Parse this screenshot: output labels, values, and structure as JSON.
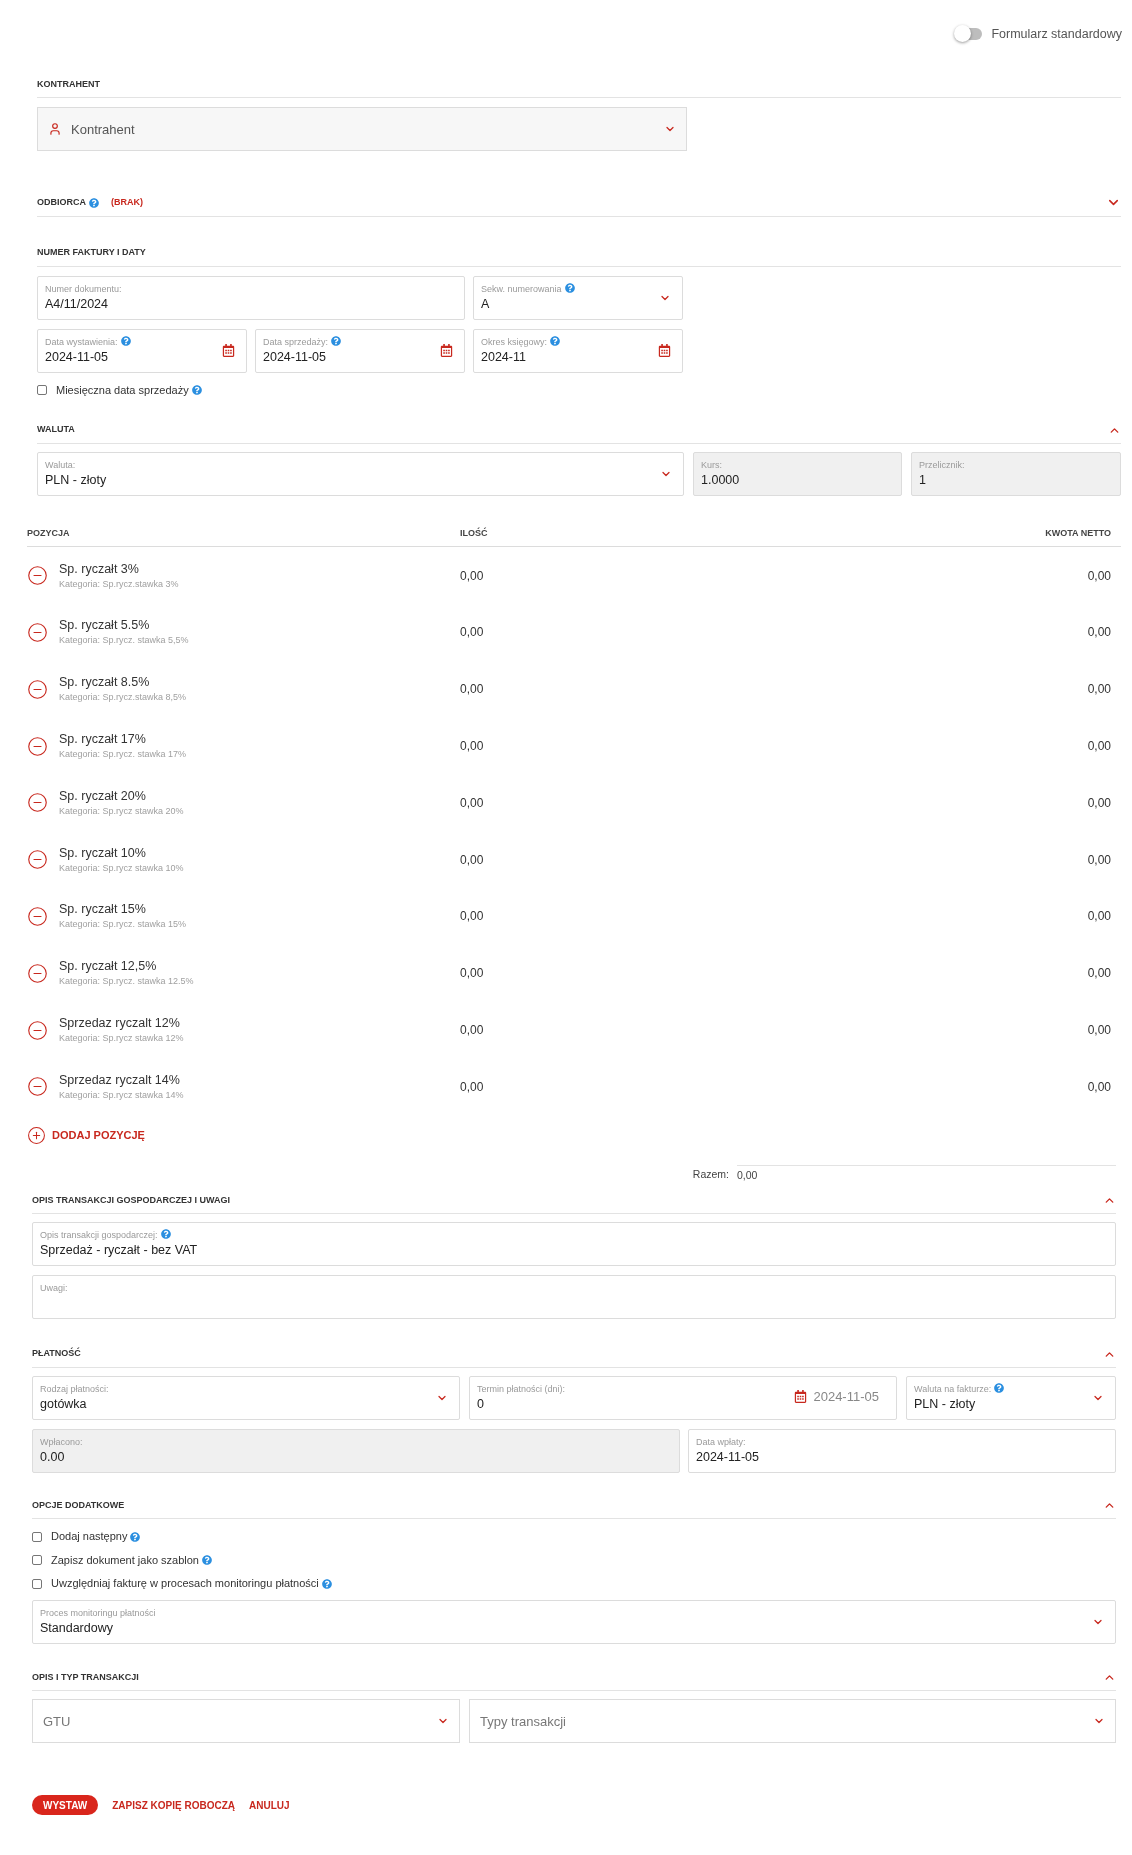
{
  "toggle": {
    "label": "Formularz standardowy",
    "on": false
  },
  "contractor": {
    "title": "KONTRAHENT",
    "placeholder": "Kontrahent"
  },
  "recipient": {
    "title": "ODBIORCA",
    "help": true,
    "status": "(BRAK)",
    "expanded": false
  },
  "invoice": {
    "title": "NUMER FAKTURY I DATY",
    "fields": [
      {
        "label": "Numer dokumentu:",
        "value": "A4/11/2024",
        "kind": "text",
        "help": false
      },
      {
        "label": "Sekw. numerowania",
        "value": "A",
        "kind": "select",
        "help": true
      },
      {
        "label": "Data wystawienia:",
        "value": "2024-11-05",
        "kind": "date",
        "help": true
      },
      {
        "label": "Data sprzedaży:",
        "value": "2024-11-05",
        "kind": "date",
        "help": true
      },
      {
        "label": "Okres księgowy:",
        "value": "2024-11",
        "kind": "date",
        "help": true
      }
    ],
    "checkbox": {
      "label": "Miesięczna data sprzedaży",
      "checked": false,
      "help": true
    }
  },
  "currency": {
    "title": "WALUTA",
    "expanded": true,
    "fields": [
      {
        "label": "Waluta:",
        "value": "PLN - złoty",
        "kind": "select",
        "help": false,
        "disabled": false
      },
      {
        "label": "Kurs:",
        "value": "1.0000",
        "kind": "text",
        "help": false,
        "disabled": true
      },
      {
        "label": "Przelicznik:",
        "value": "1",
        "kind": "text",
        "help": false,
        "disabled": true
      }
    ]
  },
  "positions": {
    "columns": [
      "POZYCJA",
      "ILOŚĆ",
      "KWOTA NETTO"
    ],
    "rows": [
      {
        "name": "Sp. ryczałt 3%",
        "category": "Kategoria: Sp.rycz.stawka 3%",
        "quantity": "0,00",
        "net": "0,00"
      },
      {
        "name": "Sp. ryczałt 5.5%",
        "category": "Kategoria: Sp.rycz. stawka 5,5%",
        "quantity": "0,00",
        "net": "0,00"
      },
      {
        "name": "Sp. ryczałt 8.5%",
        "category": "Kategoria: Sp.rycz.stawka 8,5%",
        "quantity": "0,00",
        "net": "0,00"
      },
      {
        "name": "Sp. ryczałt 17%",
        "category": "Kategoria: Sp.rycz. stawka 17%",
        "quantity": "0,00",
        "net": "0,00"
      },
      {
        "name": "Sp. ryczałt 20%",
        "category": "Kategoria: Sp.rycz stawka 20%",
        "quantity": "0,00",
        "net": "0,00"
      },
      {
        "name": "Sp. ryczałt 10%",
        "category": "Kategoria: Sp.rycz stawka 10%",
        "quantity": "0,00",
        "net": "0,00"
      },
      {
        "name": "Sp. ryczałt 15%",
        "category": "Kategoria: Sp.rycz. stawka 15%",
        "quantity": "0,00",
        "net": "0,00"
      },
      {
        "name": "Sp. ryczałt 12,5%",
        "category": "Kategoria: Sp.rycz. stawka 12.5%",
        "quantity": "0,00",
        "net": "0,00"
      },
      {
        "name": "Sprzedaz ryczalt 12%",
        "category": "Kategoria: Sp.rycz stawka 12%",
        "quantity": "0,00",
        "net": "0,00"
      },
      {
        "name": "Sprzedaz ryczalt 14%",
        "category": "Kategoria: Sp.rycz stawka 14%",
        "quantity": "0,00",
        "net": "0,00"
      }
    ],
    "add_label": "DODAJ POZYCJĘ",
    "total_label": "Razem:",
    "total": "0,00"
  },
  "description": {
    "title": "OPIS TRANSAKCJI GOSPODARCZEJ I UWAGI",
    "expanded": true,
    "fields": [
      {
        "label": "Opis transakcji gospodarczej:",
        "value": "Sprzedaż - ryczałt - bez VAT",
        "help": true
      },
      {
        "label": "Uwagi:",
        "help": false
      }
    ]
  },
  "payment": {
    "title": "PŁATNOŚĆ",
    "expanded": true,
    "fields": [
      {
        "label": "Rodzaj płatności:",
        "value": "gotówka",
        "kind": "select",
        "help": false,
        "disabled": false
      },
      {
        "label": "Termin płatności (dni):",
        "value": "0",
        "kind": "term",
        "date": "2024-11-05",
        "help": false,
        "disabled": false
      },
      {
        "label": "Waluta na fakturze:",
        "value": "PLN - złoty",
        "kind": "select",
        "help": true,
        "disabled": false
      },
      {
        "label": "Wpłacono:",
        "value": "0.00",
        "kind": "text",
        "help": false,
        "disabled": true
      },
      {
        "label": "Data wpłaty:",
        "value": "2024-11-05",
        "kind": "text",
        "help": false,
        "disabled": false
      }
    ]
  },
  "options": {
    "title": "OPCJE DODATKOWE",
    "expanded": true,
    "checkboxes": [
      {
        "label": "Dodaj następny",
        "checked": false,
        "help": true
      },
      {
        "label": "Zapisz dokument jako szablon",
        "checked": false,
        "help": true
      },
      {
        "label": "Uwzględniaj fakturę w procesach monitoringu płatności",
        "checked": false,
        "help": true
      }
    ],
    "field": {
      "label": "Proces monitoringu płatności",
      "value": "Standardowy",
      "kind": "select"
    }
  },
  "transaction": {
    "title": "OPIS I TYP TRANSAKCJI",
    "expanded": true,
    "fields": [
      {
        "placeholder": "GTU",
        "kind": "select"
      },
      {
        "placeholder": "Typy transakcji",
        "kind": "select"
      }
    ]
  },
  "actions": [
    {
      "label": "WYSTAW",
      "kind": "primary"
    },
    {
      "label": "ZAPISZ KOPIĘ ROBOCZĄ",
      "kind": "link"
    },
    {
      "label": "ANULUJ",
      "kind": "link"
    }
  ]
}
